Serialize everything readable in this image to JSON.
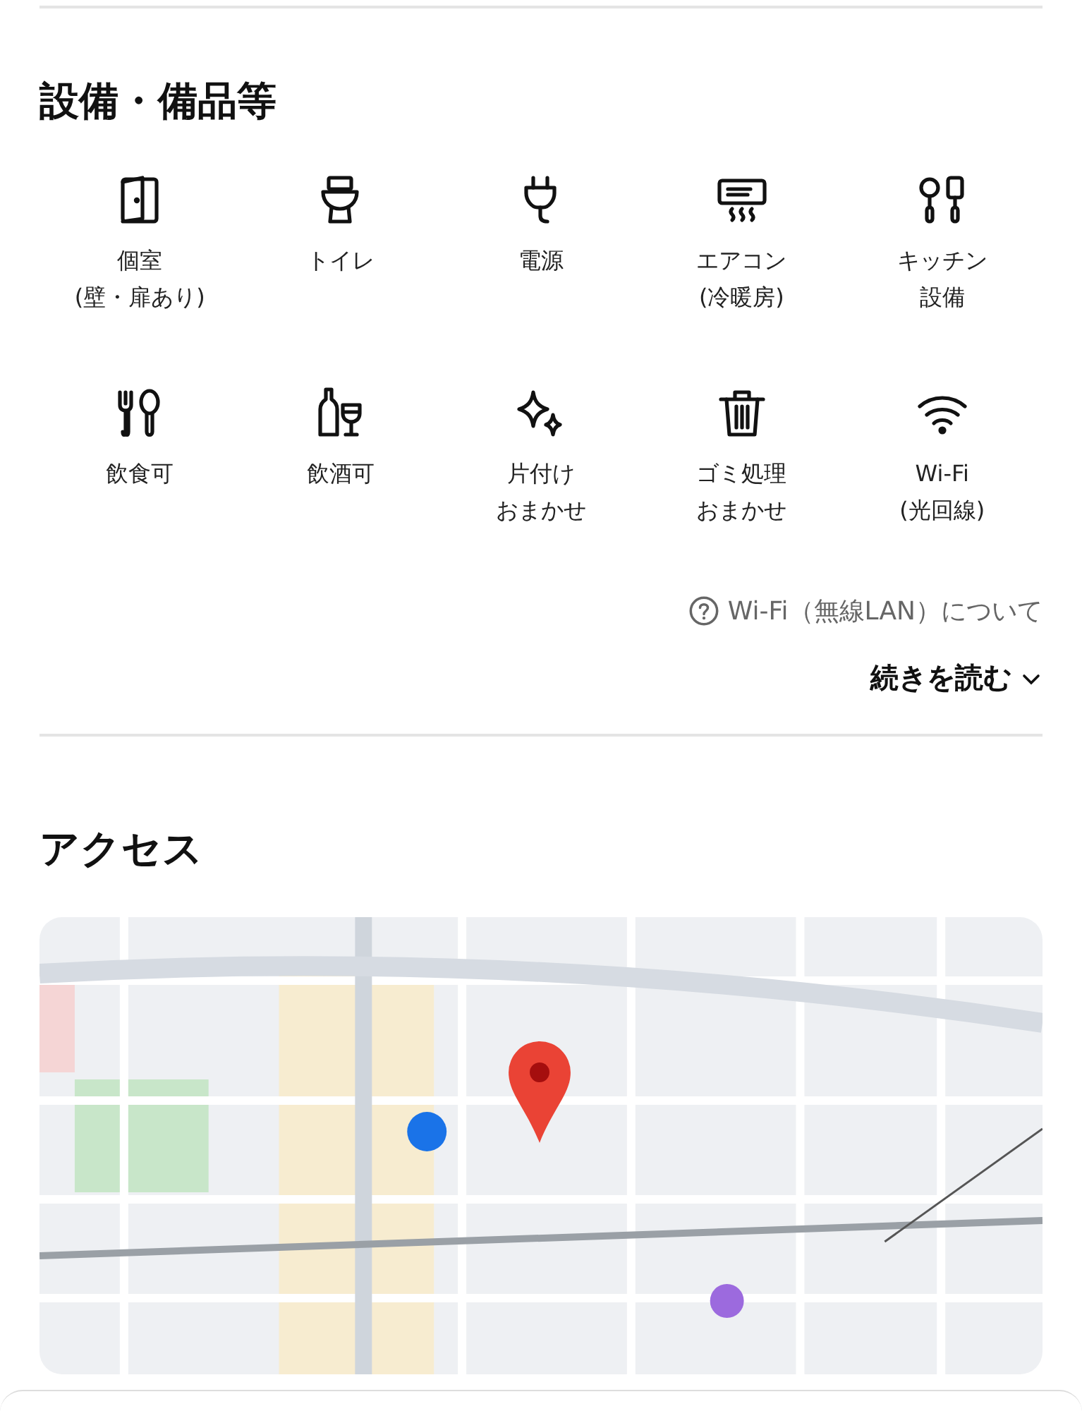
{
  "equipment": {
    "title": "設備・備品等",
    "items": [
      {
        "kind": "door",
        "lines": [
          "個室",
          "(壁・扉あり)"
        ]
      },
      {
        "kind": "toilet",
        "lines": [
          "トイレ"
        ]
      },
      {
        "kind": "plug",
        "lines": [
          "電源"
        ]
      },
      {
        "kind": "aircon",
        "lines": [
          "エアコン",
          "(冷暖房)"
        ]
      },
      {
        "kind": "kitchen",
        "lines": [
          "キッチン",
          "設備"
        ]
      },
      {
        "kind": "cutlery",
        "lines": [
          "飲食可"
        ]
      },
      {
        "kind": "drinks",
        "lines": [
          "飲酒可"
        ]
      },
      {
        "kind": "sparkle",
        "lines": [
          "片付け",
          "おまかせ"
        ]
      },
      {
        "kind": "trash",
        "lines": [
          "ゴミ処理",
          "おまかせ"
        ]
      },
      {
        "kind": "wifi",
        "lines": [
          "Wi-Fi",
          "(光回線)"
        ]
      }
    ],
    "help_link": "Wi-Fi（無線LAN）について",
    "read_more": "続きを読む"
  },
  "access": {
    "title": "アクセス"
  }
}
